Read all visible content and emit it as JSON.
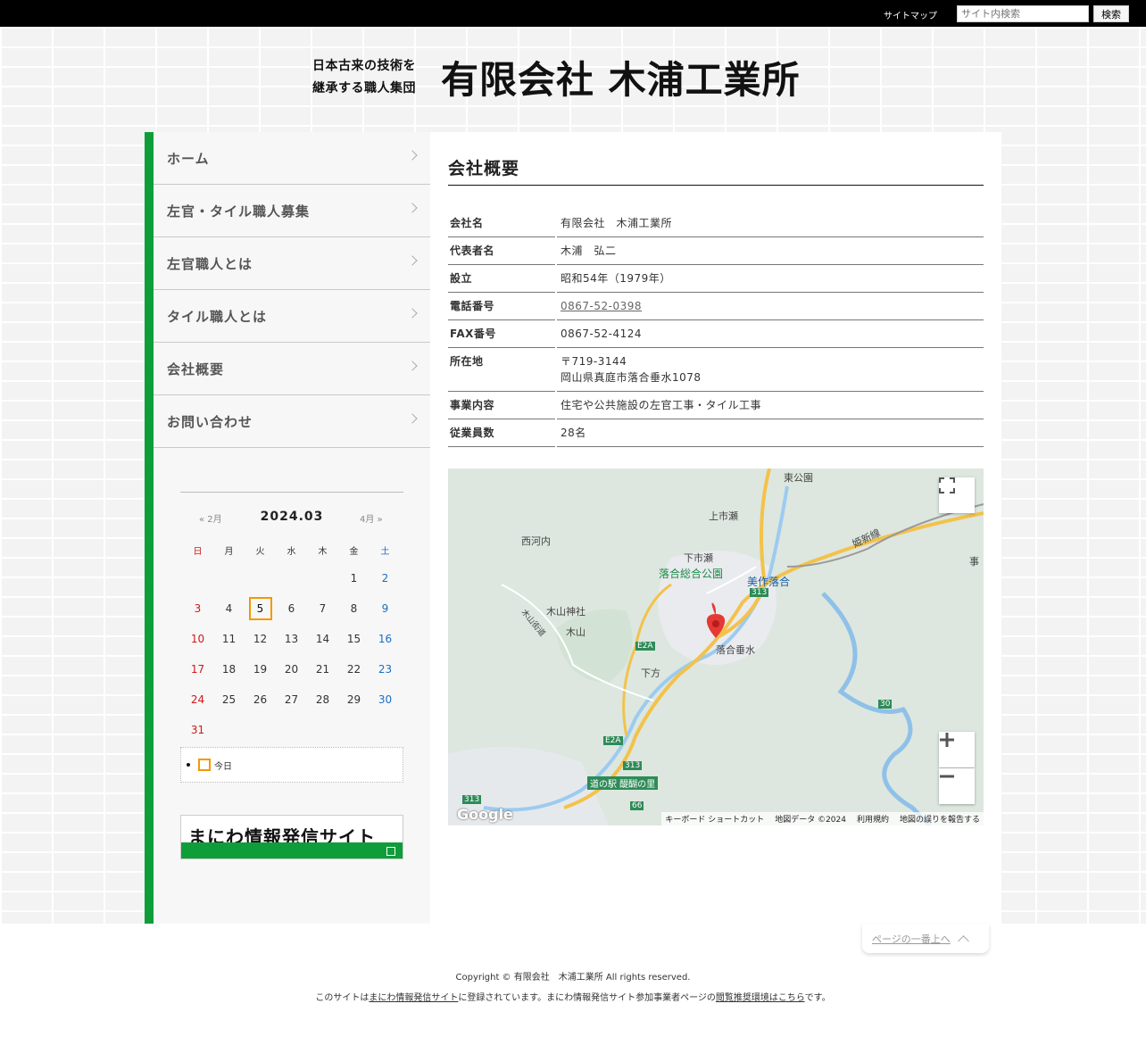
{
  "header": {
    "sitemap_label": "サイトマップ",
    "search_placeholder": "サイト内検索",
    "search_button": "検索",
    "tagline_line1": "日本古来の技術を",
    "tagline_line2": "継承する職人集団",
    "company_name": "有限会社 木浦工業所"
  },
  "nav": [
    {
      "label": "ホーム"
    },
    {
      "label": "左官・タイル職人募集"
    },
    {
      "label": "左官職人とは"
    },
    {
      "label": "タイル職人とは"
    },
    {
      "label": "会社概要"
    },
    {
      "label": "お問い合わせ"
    }
  ],
  "calendar": {
    "prev": "« 2月",
    "month": "2024.03",
    "next": "4月 »",
    "weekdays": [
      "日",
      "月",
      "火",
      "水",
      "木",
      "金",
      "土"
    ],
    "weeks": [
      [
        "",
        "",
        "",
        "",
        "",
        "1",
        "2"
      ],
      [
        "3",
        "4",
        "5",
        "6",
        "7",
        "8",
        "9"
      ],
      [
        "10",
        "11",
        "12",
        "13",
        "14",
        "15",
        "16"
      ],
      [
        "17",
        "18",
        "19",
        "20",
        "21",
        "22",
        "23"
      ],
      [
        "24",
        "25",
        "26",
        "27",
        "28",
        "29",
        "30"
      ],
      [
        "31",
        "",
        "",
        "",
        "",
        "",
        ""
      ]
    ],
    "today": "5",
    "legend_today": "今日",
    "colors": {
      "sunday": "#d01818",
      "saturday": "#1a6fc4",
      "today_border": "#f39800"
    }
  },
  "banner": {
    "text": "まにわ情報発信サイト"
  },
  "main": {
    "title": "会社概要",
    "info": [
      {
        "key": "会社名",
        "value": "有限会社　木浦工業所"
      },
      {
        "key": "代表者名",
        "value": "木浦　弘二"
      },
      {
        "key": "設立",
        "value": "昭和54年（1979年）"
      },
      {
        "key": "電話番号",
        "value": "0867-52-0398"
      },
      {
        "key": "FAX番号",
        "value": "0867-52-4124"
      },
      {
        "key": "所在地",
        "value": "〒719-3144",
        "value2": "岡山県真庭市落合垂水1078"
      },
      {
        "key": "事業内容",
        "value": "住宅や公共施設の左官工事・タイル工事"
      },
      {
        "key": "従業員数",
        "value": "28名"
      }
    ]
  },
  "map": {
    "labels": {
      "higashi_koen": "東公園",
      "kamiichise": "上市瀬",
      "nishikochi": "西河内",
      "shimoichise": "下市瀬",
      "ochiai_park": "落合総合公園",
      "mimasaka_ochiai": "美作落合",
      "kiyama_jinja": "木山神社",
      "kiyama": "木山",
      "kiyama_kaido": "木山街道",
      "shimokata": "下方",
      "ochiai_tarumi": "落合垂水",
      "daigo_station": "道の駅 醍醐の里",
      "himeshin_line": "姫新線",
      "koto": "事"
    },
    "route_numbers": [
      "313",
      "E2A",
      "E2A",
      "313",
      "30",
      "66",
      "313"
    ],
    "footer": [
      "キーボード ショートカット",
      "地図データ ©2024",
      "利用規約",
      "地図の誤りを報告する"
    ],
    "google": "Google"
  },
  "footer": {
    "to_top": "ページの一番上へ",
    "copyright": "Copyright © 有限会社　木浦工業所 All rights reserved.",
    "note_prefix": "このサイトは",
    "note_link1": "まにわ情報発信サイト",
    "note_middle": "に登録されています。まにわ情報発信サイト参加事業者ページの",
    "note_link2": "閲覧推奨環境はこちら",
    "note_suffix": "です。"
  }
}
